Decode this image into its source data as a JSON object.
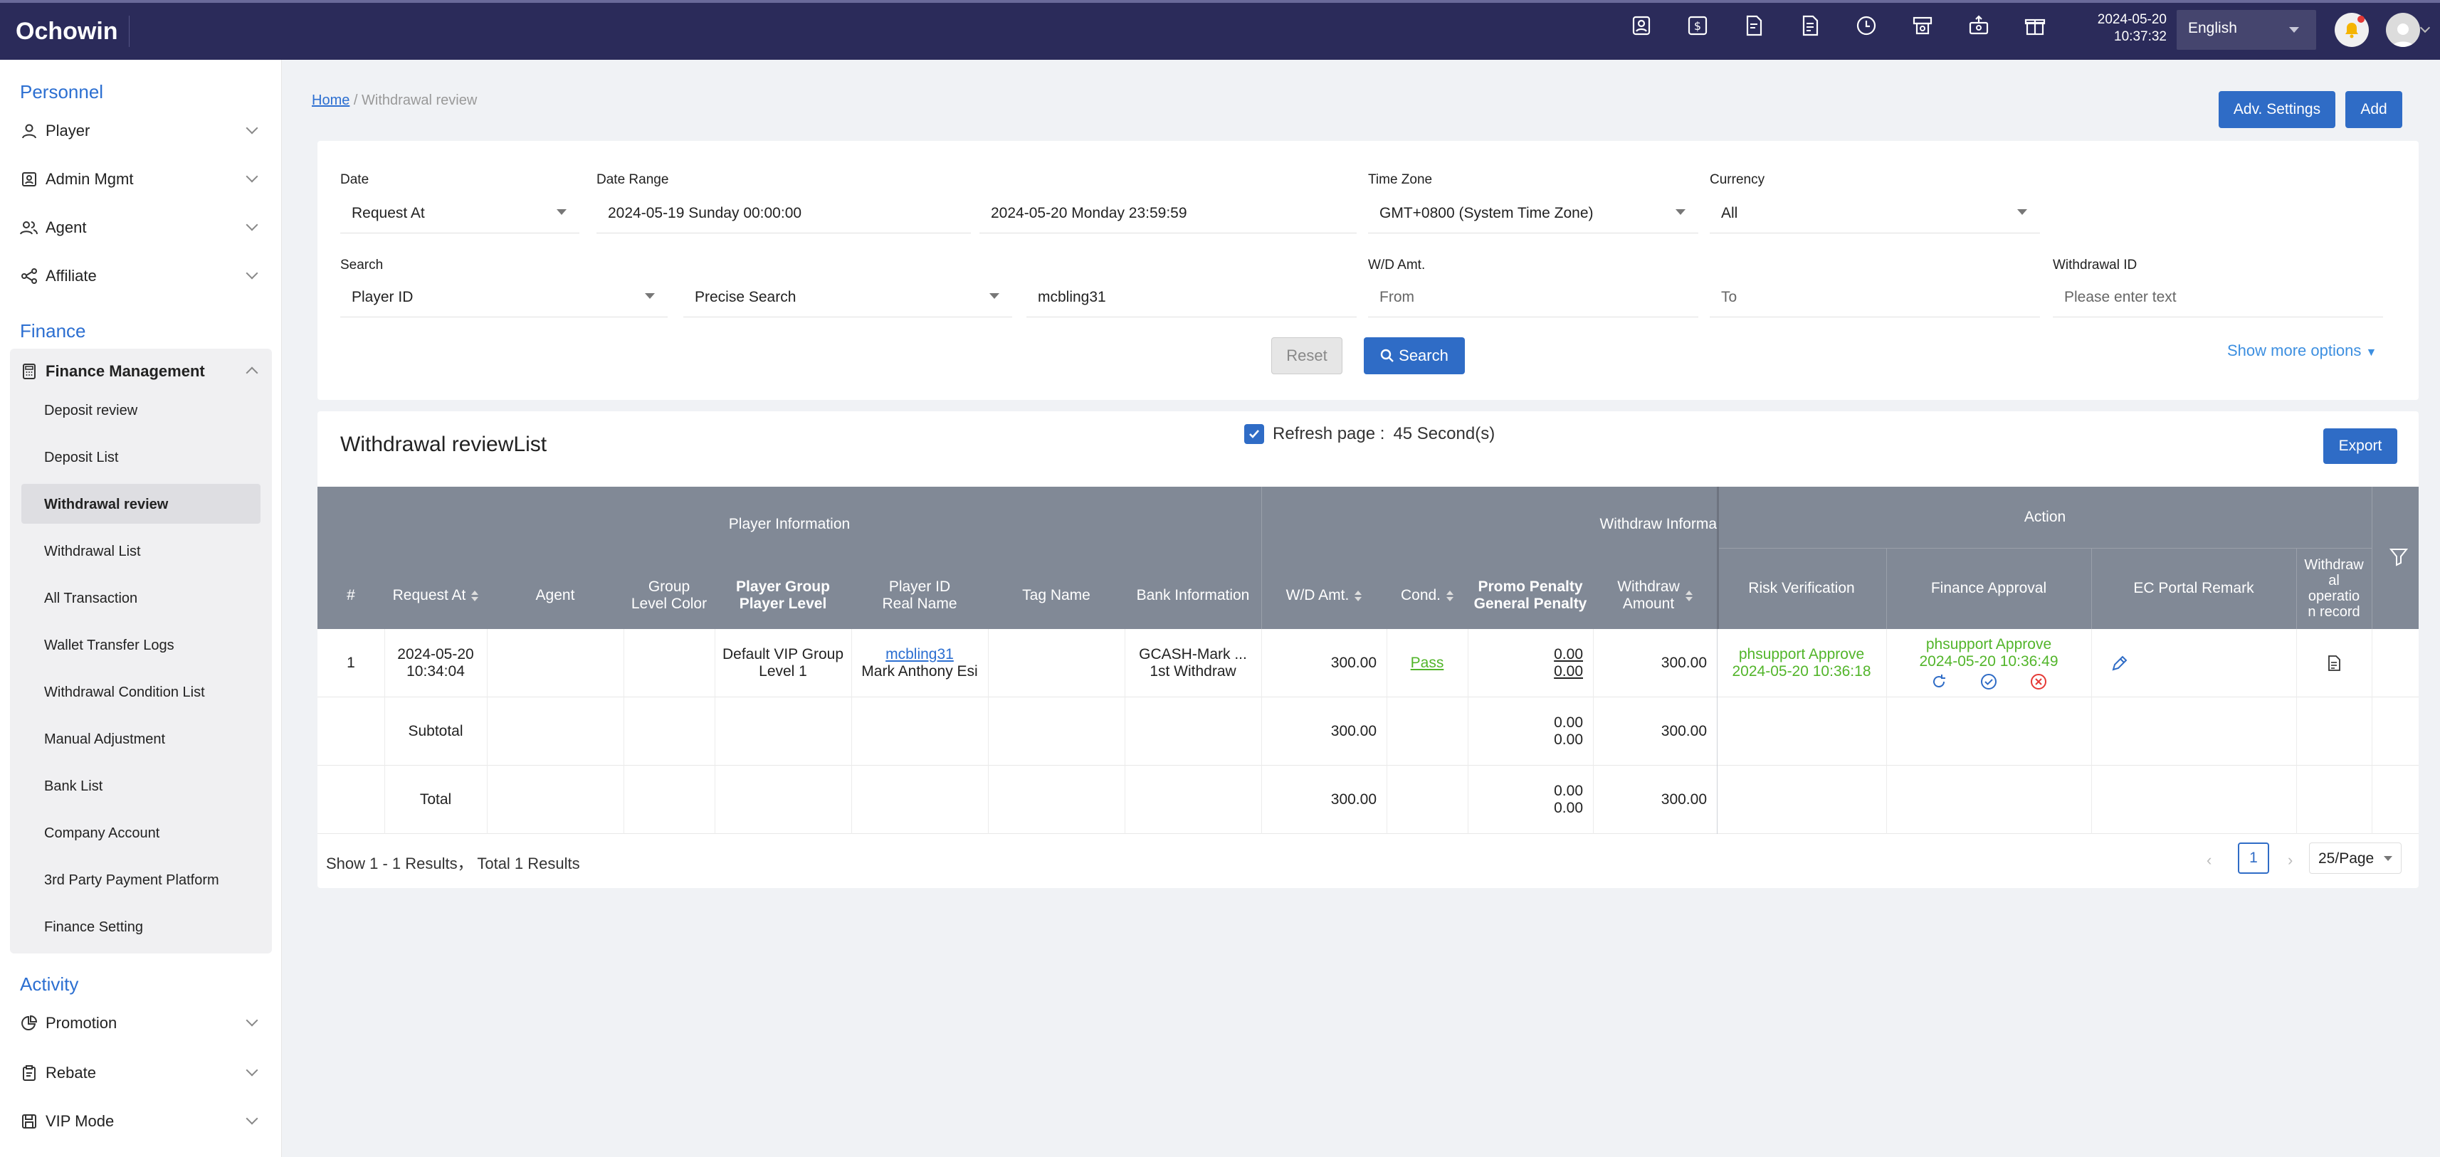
{
  "app": {
    "brand": "Ochowin",
    "date": "2024-05-20",
    "time": "10:37:32",
    "language": "English",
    "icons": [
      "person-badge-icon",
      "dollar-icon",
      "document-user-icon",
      "document-dollar-icon",
      "clock-icon",
      "atm-icon",
      "cash-out-icon",
      "gift-icon"
    ]
  },
  "sidebar": {
    "sections": {
      "personnel": "Personnel",
      "finance": "Finance",
      "activity": "Activity"
    },
    "personnel_items": [
      "Player",
      "Admin Mgmt",
      "Agent",
      "Affiliate"
    ],
    "finance_group": "Finance Management",
    "finance_items": [
      "Deposit review",
      "Deposit List",
      "Withdrawal review",
      "Withdrawal List",
      "All Transaction",
      "Wallet Transfer Logs",
      "Withdrawal Condition List",
      "Manual Adjustment",
      "Bank List",
      "Company Account",
      "3rd Party Payment Platform",
      "Finance Setting"
    ],
    "activity_items": [
      "Promotion",
      "Rebate",
      "VIP Mode"
    ]
  },
  "breadcrumb": {
    "home": "Home",
    "sep": " / ",
    "current": "Withdrawal review"
  },
  "header_buttons": {
    "adv_settings": "Adv. Settings",
    "add": "Add"
  },
  "filters": {
    "date_label": "Date",
    "date_value": "Request At",
    "range_label": "Date Range",
    "range_start": "2024-05-19 Sunday 00:00:00",
    "range_end": "2024-05-20 Monday 23:59:59",
    "tz_label": "Time Zone",
    "tz_value": "GMT+0800 (System Time Zone)",
    "currency_label": "Currency",
    "currency_value": "All",
    "search_label": "Search",
    "search_field": "Player ID",
    "search_mode": "Precise Search",
    "search_value": "mcbling31",
    "amt_label": "W/D Amt.",
    "amt_from": "From",
    "amt_to": "To",
    "wid_label": "Withdrawal ID",
    "wid_placeholder": "Please enter text",
    "reset": "Reset",
    "search": "Search",
    "more": "Show more options"
  },
  "list": {
    "title": "Withdrawal reviewList",
    "refresh_label": "Refresh page :",
    "refresh_value": "45 Second(s)",
    "export": "Export",
    "groups": {
      "player": "Player Information",
      "withdraw": "Withdraw Informa",
      "action": "Action"
    },
    "columns": {
      "num": "#",
      "request_at": "Request At",
      "agent": "Agent",
      "group_color_1": "Group",
      "group_color_2": "Level Color",
      "player_group_1": "Player Group",
      "player_group_2": "Player Level",
      "player_id_1": "Player ID",
      "player_id_2": "Real Name",
      "tag": "Tag Name",
      "bank": "Bank Information",
      "wd_amt": "W/D Amt.",
      "cond": "Cond.",
      "promo_1": "Promo Penalty",
      "promo_2": "General Penalty",
      "wamt_1": "Withdraw",
      "wamt_2": "Amount",
      "risk": "Risk Verification",
      "finance": "Finance Approval",
      "ec": "EC Portal Remark",
      "op_1": "Withdraw",
      "op_2": "al",
      "op_3": "operatio",
      "op_4": "n record"
    },
    "row": {
      "num": "1",
      "date": "2024-05-20",
      "time": "10:34:04",
      "group": "Default VIP Group",
      "level": "Level 1",
      "player_id": "mcbling31",
      "real_name": "Mark Anthony Esi",
      "bank_1": "GCASH-Mark ...",
      "bank_2": "1st Withdraw",
      "wd_amt": "300.00",
      "cond": "Pass",
      "promo": "0.00",
      "general": "0.00",
      "wamt": "300.00",
      "risk_1": "phsupport Approve",
      "risk_2": "2024-05-20 10:36:18",
      "fin_1": "phsupport Approve",
      "fin_2": "2024-05-20 10:36:49"
    },
    "subtotal": {
      "label": "Subtotal",
      "wd_amt": "300.00",
      "promo": "0.00",
      "general": "0.00",
      "wamt": "300.00"
    },
    "total": {
      "label": "Total",
      "wd_amt": "300.00",
      "promo": "0.00",
      "general": "0.00",
      "wamt": "300.00"
    },
    "footer": "Show 1 - 1 Results， Total 1 Results",
    "page": "1",
    "page_size": "25/Page"
  },
  "colors": {
    "topbar": "#2b2b5a",
    "accent": "#2f6cc6",
    "header": "#818996",
    "approve": "#52b52a"
  }
}
